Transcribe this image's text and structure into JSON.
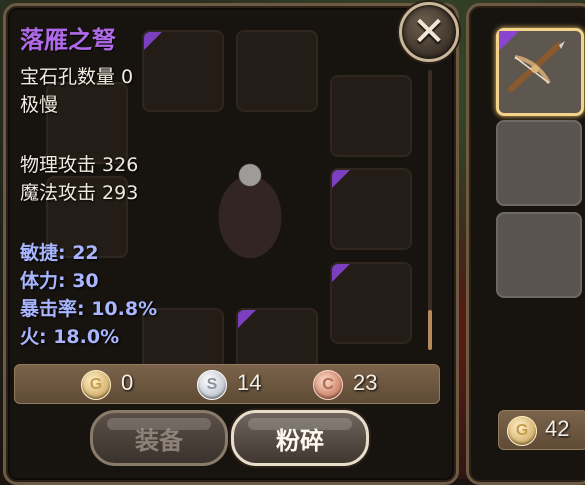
{
  "item": {
    "name": "落雁之弩",
    "gem_slots": "宝石孔数量 0",
    "speed": "极慢",
    "physical_attack": "物理攻击 326",
    "magic_attack": "魔法攻击 293",
    "bonuses": [
      "敏捷: 22",
      "体力: 30",
      "暴击率: 10.8%",
      "火: 18.0%"
    ]
  },
  "currency": {
    "gold": {
      "icon": "G",
      "amount": "0"
    },
    "silver": {
      "icon": "S",
      "amount": "14"
    },
    "copper": {
      "icon": "C",
      "amount": "23"
    }
  },
  "buttons": {
    "equip": "装备",
    "smash": "粉碎",
    "close": "✕"
  },
  "side_panel": {
    "coin_icon": "G",
    "coin_amount": "42"
  },
  "colors": {
    "item_name": "#b06ae8",
    "bonus_stat": "#a9b6ff",
    "selected_border": "#f3d48a"
  }
}
